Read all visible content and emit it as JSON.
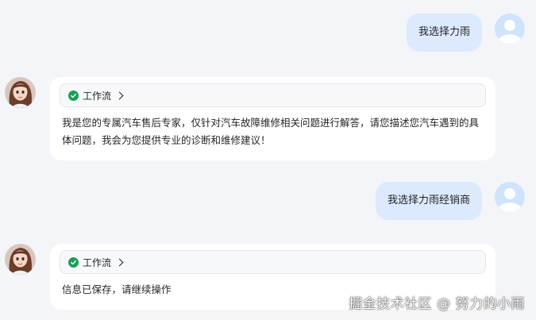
{
  "conversation": {
    "messages": [
      {
        "role": "user",
        "text": "我选择力雨"
      },
      {
        "role": "bot",
        "workflow_label": "工作流",
        "text": "我是您的专属汽车售后专家，仅针对汽车故障维修相关问题进行解答，请您描述您汽车遇到的具体问题，我会为您提供专业的诊断和维修建议！"
      },
      {
        "role": "user",
        "text": "我选择力雨经销商"
      },
      {
        "role": "bot",
        "workflow_label": "工作流",
        "text": "信息已保存，请继续操作"
      }
    ]
  },
  "watermark": "掘金技术社区 @ 努力的小雨",
  "colors": {
    "page_background": "#f4f5f8",
    "user_bubble": "#dde9fc",
    "workflow_check": "#18a058",
    "user_avatar_bg": "#cfe4fb"
  },
  "icons": {
    "user_avatar": "user-silhouette-icon",
    "bot_avatar": "girl-portrait-icon",
    "workflow_status": "check-circle-icon",
    "workflow_expand": "chevron-right-icon"
  }
}
